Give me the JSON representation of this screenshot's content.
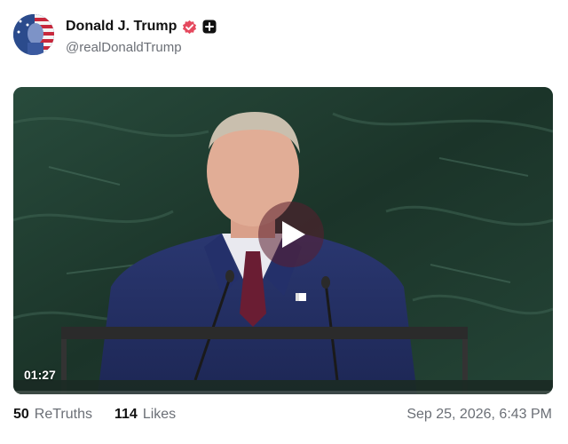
{
  "author": {
    "display_name": "Donald J. Trump",
    "handle": "@realDonaldTrump",
    "avatar_icon": "flag-portrait-avatar",
    "badges": [
      "verified-badge-icon",
      "plus-badge-icon"
    ]
  },
  "video": {
    "duration": "01:27",
    "play_icon": "play-icon"
  },
  "stats": {
    "retruths_count": "50",
    "retruths_label": "ReTruths",
    "likes_count": "114",
    "likes_label": "Likes"
  },
  "timestamp": "Sep 25, 2026, 6:43 PM",
  "colors": {
    "verified": "#e5495e",
    "text_primary": "#111111",
    "text_secondary": "#6b6f76",
    "video_background": "#1f3a2e"
  }
}
